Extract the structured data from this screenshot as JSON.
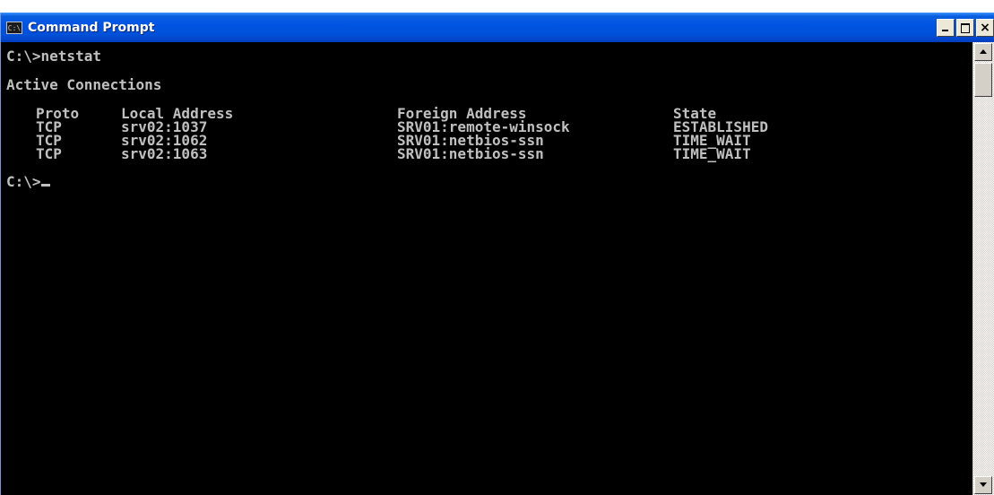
{
  "window": {
    "title": "Command Prompt",
    "icon": "console-icon",
    "icon_text": "C:\\",
    "buttons": [
      "minimize",
      "maximize",
      "close"
    ],
    "close_glyph": "×"
  },
  "console": {
    "command_line": "C:\\>netstat",
    "section_title": "Active Connections",
    "columns": [
      "Proto",
      "Local Address",
      "Foreign Address",
      "State"
    ],
    "rows": [
      [
        "TCP",
        "srv02:1037",
        "SRV01:remote-winsock",
        "ESTABLISHED"
      ],
      [
        "TCP",
        "srv02:1062",
        "SRV01:netbios-ssn",
        "TIME_WAIT"
      ],
      [
        "TCP",
        "srv02:1063",
        "SRV01:netbios-ssn",
        "TIME_WAIT"
      ]
    ],
    "prompt": "C:\\>"
  },
  "colors": {
    "title_bar": "#0054e3",
    "console_bg": "#000000",
    "console_text": "#c0c0c0"
  }
}
